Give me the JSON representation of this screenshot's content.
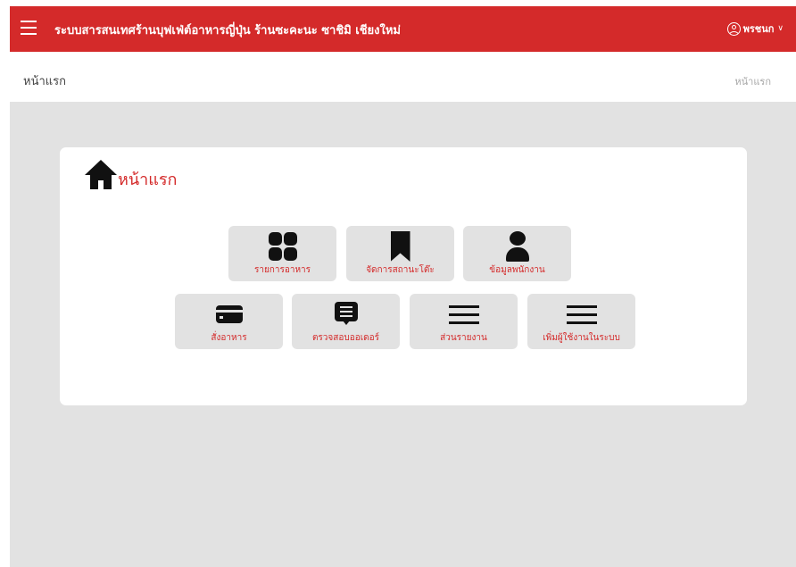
{
  "header": {
    "app_title": "ระบบสารสนเทศร้านบุฟเฟ่ต์อาหารญี่ปุ่น ร้านซะคะนะ ซาชิมิ เชียงใหม่",
    "user_name": "พรชนก",
    "caret": "∨",
    "menu_icon": "hamburger-icon",
    "user_icon": "user-circle-icon"
  },
  "breadcrumb_bar": {
    "page_heading": "หน้าแรก",
    "breadcrumb": "หน้าแรก"
  },
  "card": {
    "title": "หน้าแรก",
    "title_icon": "home-icon"
  },
  "tiles": [
    {
      "label": "รายการอาหาร",
      "icon": "grid-icon"
    },
    {
      "label": "จัดการสถานะโต๊ะ",
      "icon": "bookmark-icon"
    },
    {
      "label": "ข้อมูลพนักงาน",
      "icon": "person-icon"
    },
    {
      "label": "สั่งอาหาร",
      "icon": "credit-card-icon"
    },
    {
      "label": "ตรวจสอบออเดอร์",
      "icon": "message-icon"
    },
    {
      "label": "ส่วนรายงาน",
      "icon": "menu-icon"
    },
    {
      "label": "เพิ่มผู้ใช้งานในระบบ",
      "icon": "menu-icon"
    }
  ],
  "colors": {
    "brand_red": "#d42a2a",
    "background_gray": "#e2e2e2",
    "tile_gray": "#e2e2e2",
    "icon_black": "#111111"
  }
}
